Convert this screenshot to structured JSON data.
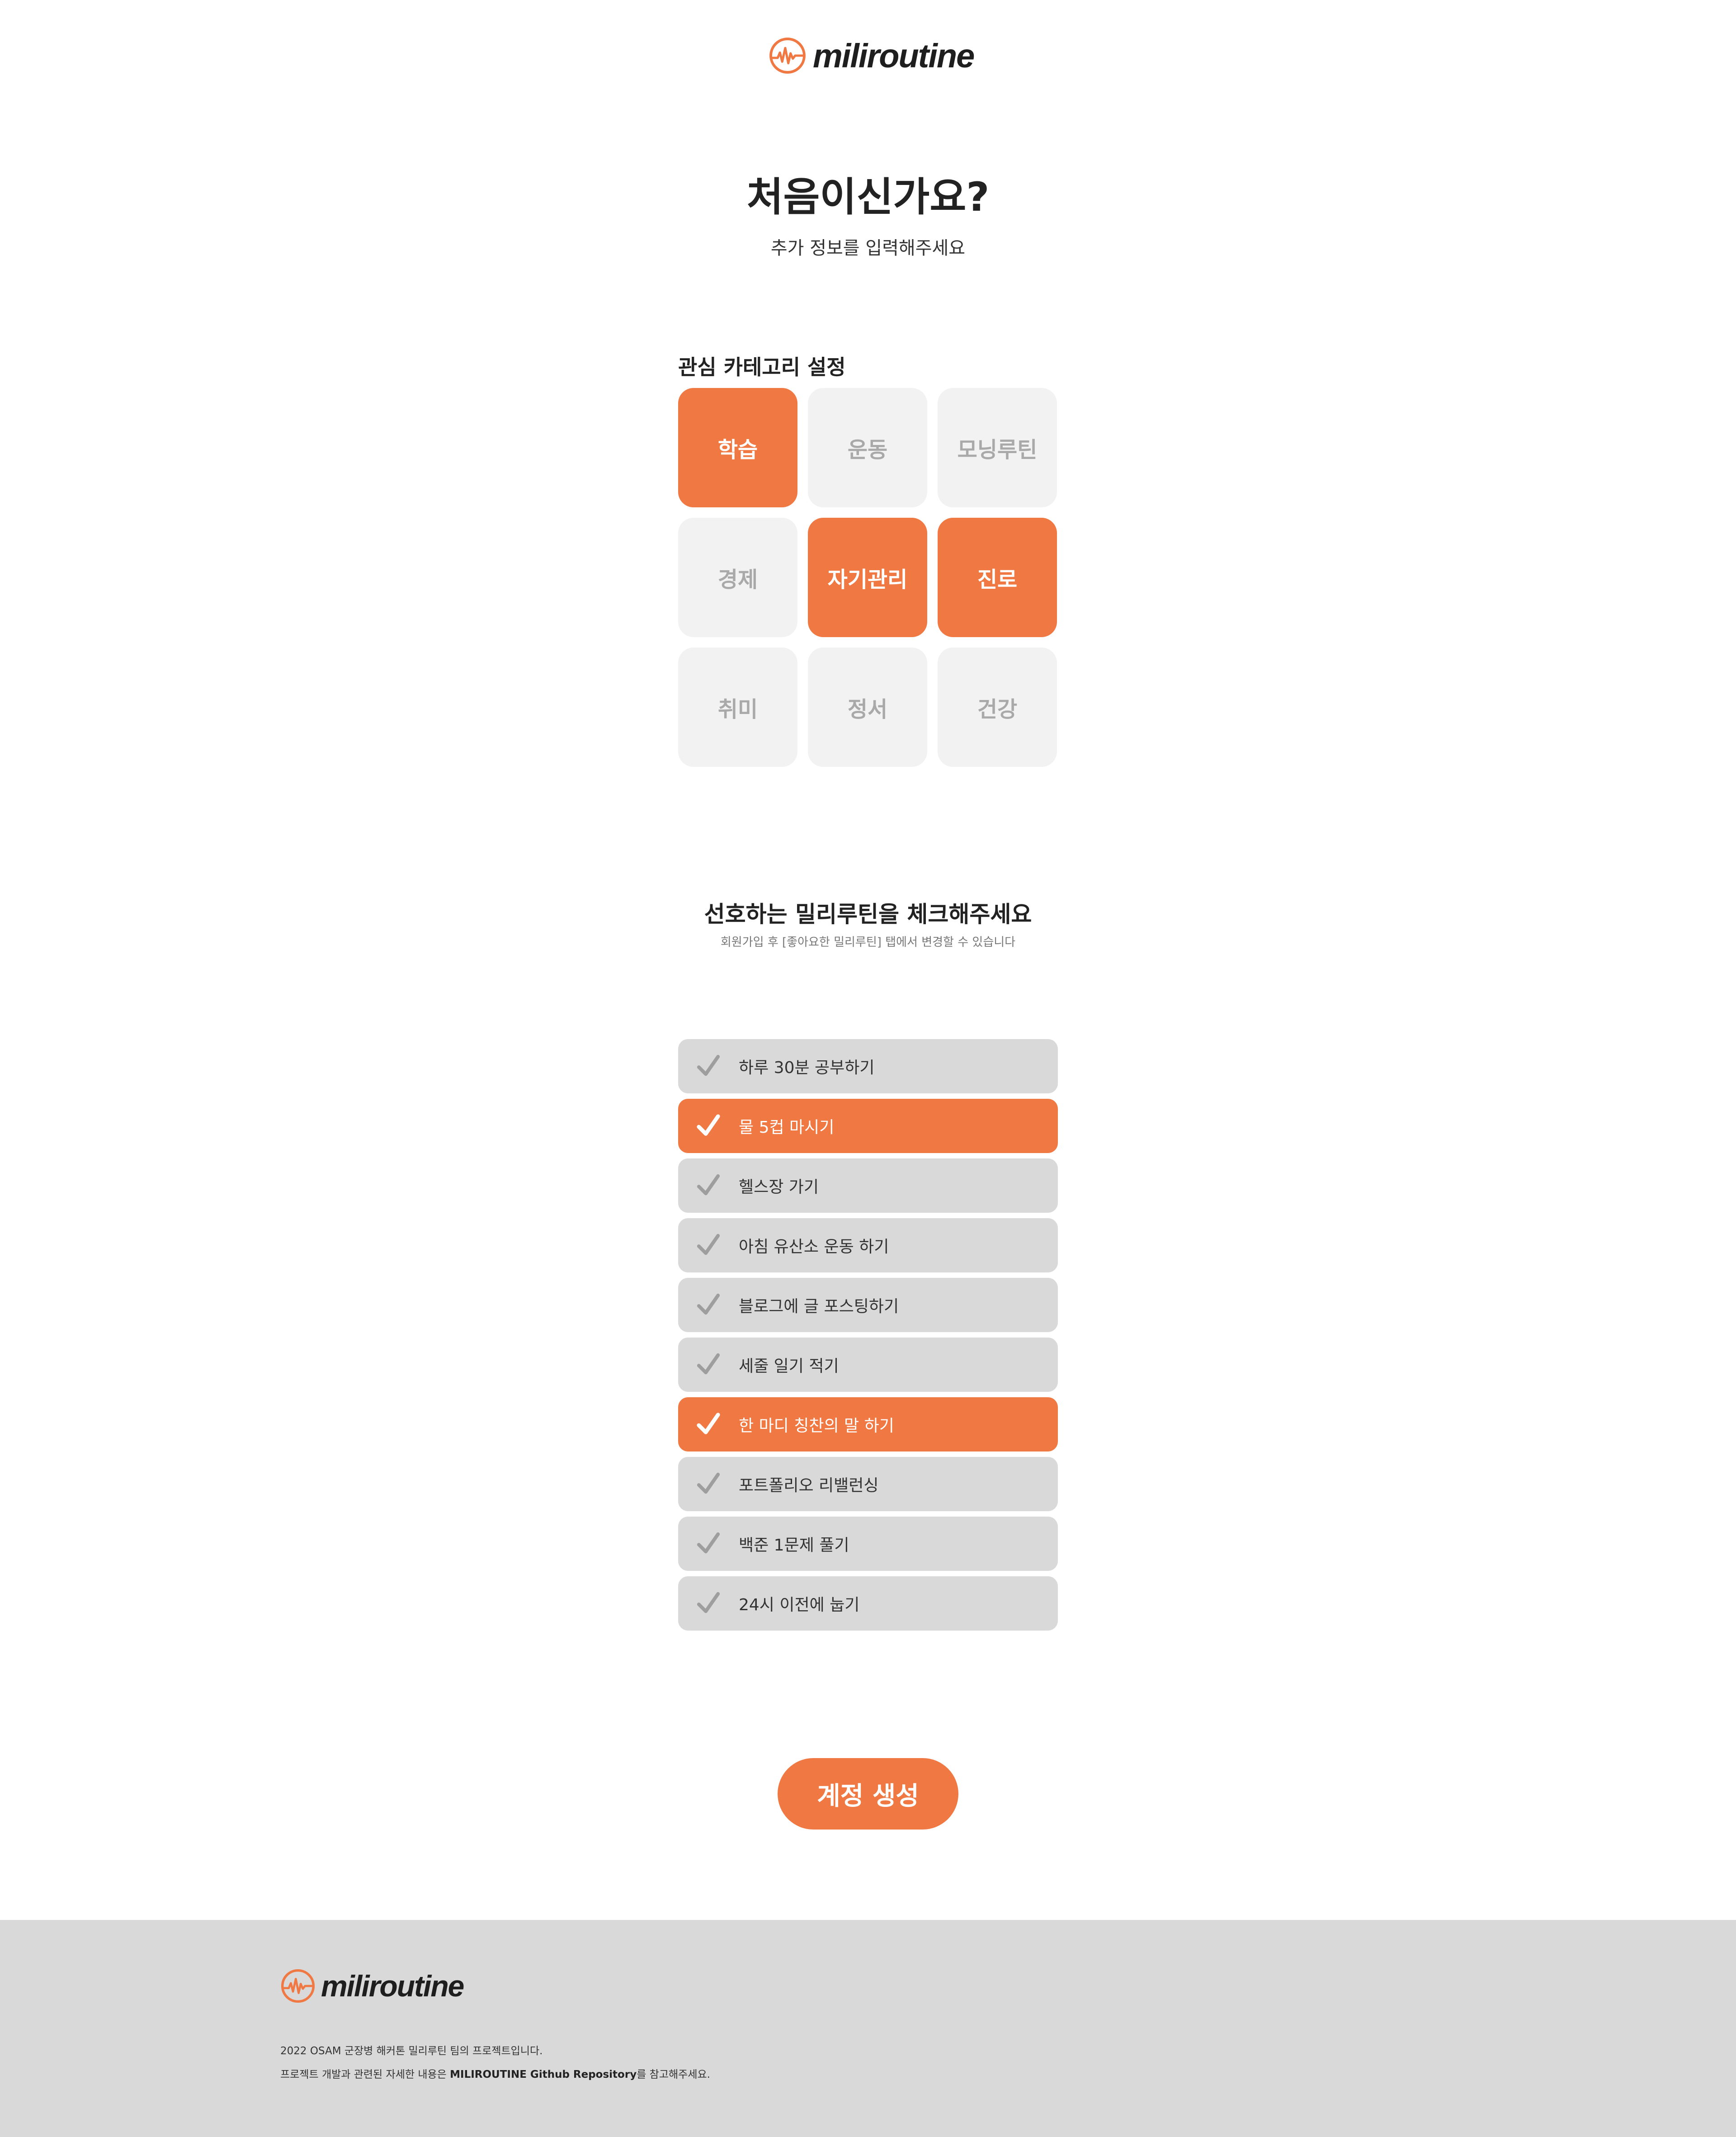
{
  "brand": {
    "name": "miliroutine",
    "accent": "#f07843"
  },
  "header": {
    "logo_text": "miliroutine"
  },
  "intro": {
    "title": "처음이신가요?",
    "subtitle": "추가 정보를 입력해주세요"
  },
  "categories": {
    "heading": "관심 카테고리 설정",
    "items": [
      {
        "label": "학습",
        "selected": true
      },
      {
        "label": "운동",
        "selected": false
      },
      {
        "label": "모닝루틴",
        "selected": false
      },
      {
        "label": "경제",
        "selected": false
      },
      {
        "label": "자기관리",
        "selected": true
      },
      {
        "label": "진로",
        "selected": true
      },
      {
        "label": "취미",
        "selected": false
      },
      {
        "label": "정서",
        "selected": false
      },
      {
        "label": "건강",
        "selected": false
      }
    ]
  },
  "routines": {
    "heading": "선호하는 밀리루틴을 체크해주세요",
    "subheading": "회원가입 후 [좋아요한 밀리루틴] 탭에서 변경할 수 있습니다",
    "items": [
      {
        "label": "하루 30분 공부하기",
        "checked": false
      },
      {
        "label": "물 5컵 마시기",
        "checked": true
      },
      {
        "label": "헬스장 가기",
        "checked": false
      },
      {
        "label": "아침 유산소 운동 하기",
        "checked": false
      },
      {
        "label": "블로그에 글 포스팅하기",
        "checked": false
      },
      {
        "label": "세줄 일기 적기",
        "checked": false
      },
      {
        "label": "한 마디 칭찬의 말 하기",
        "checked": true
      },
      {
        "label": "포트폴리오 리밸런싱",
        "checked": false
      },
      {
        "label": "백준 1문제 풀기",
        "checked": false
      },
      {
        "label": "24시 이전에 눕기",
        "checked": false
      }
    ]
  },
  "actions": {
    "create_account_label": "계정 생성"
  },
  "footer": {
    "logo_text": "miliroutine",
    "line1": "2022 OSAM 군장병 해커톤 밀리루틴 팀의 프로젝트입니다.",
    "line2_prefix": "프로젝트 개발과 관련된 자세한 내용은 ",
    "line2_bold": "MILIROUTINE Github Repository",
    "line2_suffix": "를 참고해주세요."
  },
  "icons": {
    "logo_mark": "heartbeat-circle-icon",
    "check": "check-icon"
  }
}
